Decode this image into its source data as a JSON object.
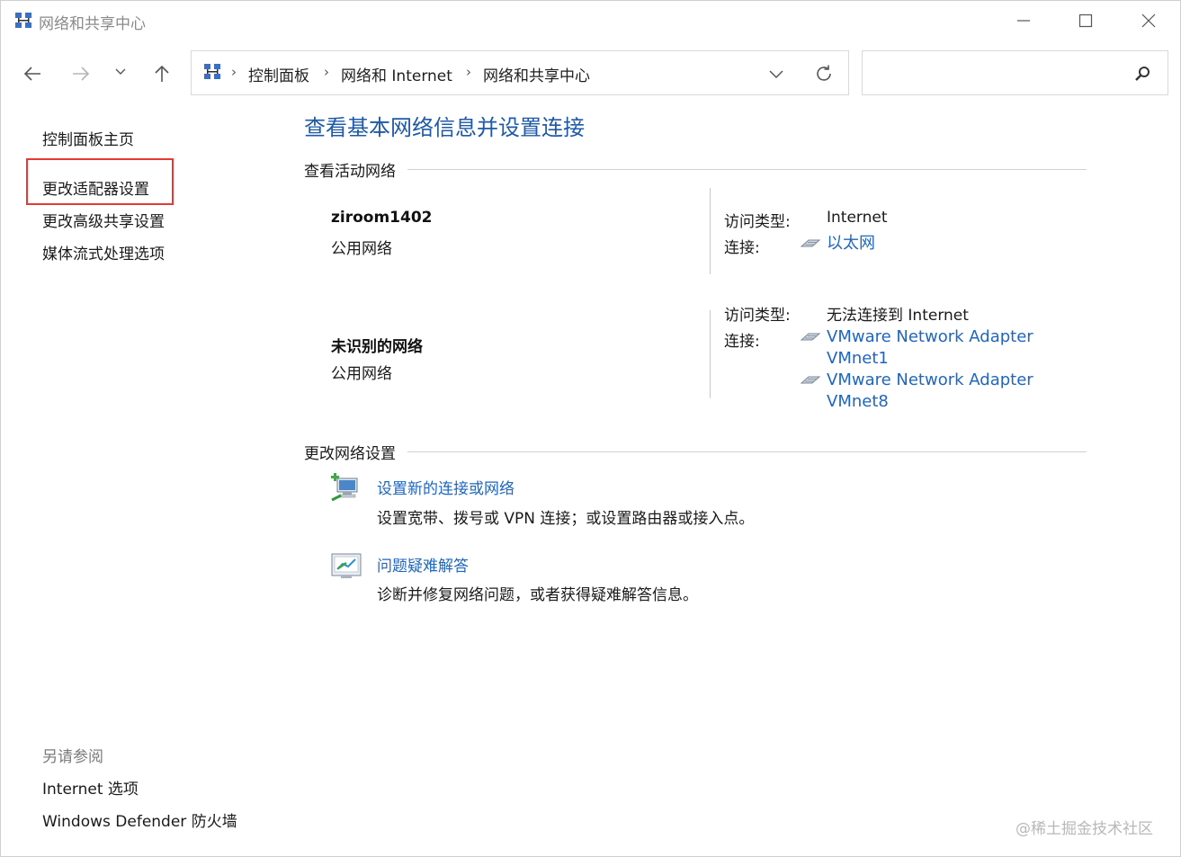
{
  "window": {
    "title": "网络和共享中心",
    "controls": {
      "minimize": "minimize-icon",
      "maximize": "maximize-icon",
      "close": "close-icon"
    }
  },
  "nav": {
    "back": "back-arrow-icon",
    "forward": "forward-arrow-icon",
    "recent": "chevron-down-icon",
    "up": "up-arrow-icon"
  },
  "address": {
    "breadcrumbs": [
      "控制面板",
      "网络和 Internet",
      "网络和共享中心"
    ],
    "separator": "›"
  },
  "search": {
    "placeholder": "",
    "value": ""
  },
  "left_pane": {
    "home": "控制面板主页",
    "links": [
      "更改适配器设置",
      "更改高级共享设置",
      "媒体流式处理选项"
    ],
    "see_also_label": "另请参阅",
    "see_also": [
      "Internet 选项",
      "Windows Defender 防火墙"
    ]
  },
  "main": {
    "title": "查看基本网络信息并设置连接",
    "active_networks_label": "查看活动网络",
    "networks": [
      {
        "name": "ziroom1402",
        "type": "公用网络",
        "access_label": "访问类型:",
        "access_value": "Internet",
        "connection_label": "连接:",
        "connections": [
          "以太网"
        ]
      },
      {
        "name": "未识别的网络",
        "type": "公用网络",
        "access_label": "访问类型:",
        "access_value": "无法连接到 Internet",
        "connection_label": "连接:",
        "connections": [
          "VMware Network Adapter VMnet1",
          "VMware Network Adapter VMnet8"
        ]
      }
    ],
    "change_settings_label": "更改网络设置",
    "tasks": [
      {
        "title": "设置新的连接或网络",
        "description": "设置宽带、拨号或 VPN 连接；或设置路由器或接入点。",
        "icon": "new-connection-icon"
      },
      {
        "title": "问题疑难解答",
        "description": "诊断并修复网络问题，或者获得疑难解答信息。",
        "icon": "troubleshoot-icon"
      }
    ]
  },
  "watermark": "@稀土掘金技术社区",
  "colors": {
    "link": "#1e66c0",
    "title": "#1e5aa8",
    "highlight": "#e53935"
  }
}
